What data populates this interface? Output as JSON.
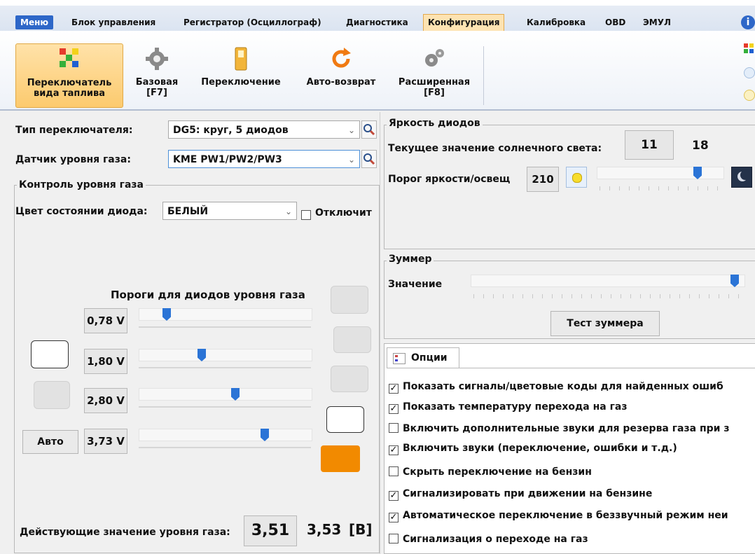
{
  "menu": {
    "tabs": [
      "Меню",
      "Блок управления",
      "Регистратор (Осциллограф)",
      "Диагностика",
      "Конфигурация",
      "Калибровка",
      "OBD",
      "ЭМУЛ"
    ],
    "active": "Конфигурация"
  },
  "ribbon": {
    "buttons": [
      {
        "label": "Переключатель вида таплива",
        "icon": "fuel-switch-icon"
      },
      {
        "label": "Базовая [F7]",
        "icon": "gear-icon"
      },
      {
        "label": "Переключение",
        "icon": "switch-icon"
      },
      {
        "label": "Авто-возврат",
        "icon": "refresh-icon"
      },
      {
        "label": "Расширенная [F8]",
        "icon": "gears-icon"
      }
    ]
  },
  "left": {
    "switch_type_label": "Тип переключателя:",
    "switch_type_value": "DG5: круг, 5 диодов",
    "sensor_label": "Датчик уровня газа:",
    "sensor_value": "KME PW1/PW2/PW3",
    "gas_group_title": "Контроль уровня газа",
    "led_color_label": "Цвет состоянии диода:",
    "led_color_value": "БЕЛЫЙ",
    "disable_label": "Отключит",
    "thresholds_title": "Пороги для диодов уровня газа",
    "thresholds": [
      {
        "value": "0,78 V",
        "fraction": 0.16
      },
      {
        "value": "1,80 V",
        "fraction": 0.37
      },
      {
        "value": "2,80 V",
        "fraction": 0.55
      },
      {
        "value": "3,73 V",
        "fraction": 0.73
      }
    ],
    "auto_button": "Авто",
    "current_label": "Действующие значение уровня газа:",
    "current_value": "3,51",
    "current_value2": "3,53",
    "unit": "[В]"
  },
  "brightness": {
    "title": "Яркость диодов",
    "sun_label": "Текущее значение солнечного света:",
    "sun_value1": "11",
    "sun_value2": "18",
    "threshold_label": "Порог яркости/освещ",
    "threshold_value": "210",
    "slider_fraction": 0.82
  },
  "buzzer": {
    "title": "Зуммер",
    "value_label": "Значение",
    "test_button": "Тест зуммера",
    "slider_fraction": 0.98
  },
  "options": {
    "tab_label": "Опции",
    "items": [
      {
        "label": "Показать сигналы/цветовые коды для найденных ошиб",
        "checked": true
      },
      {
        "label": "Показать температуру перехода на газ",
        "checked": true
      },
      {
        "label": "Включить дополнительные звуки для резерва газа при з",
        "checked": false
      },
      {
        "label": "Включить звуки (переключение, ошибки и т.д.)",
        "checked": true
      },
      {
        "label": "Скрыть переключение на бензин",
        "checked": false
      },
      {
        "label": "Сигнализировать при движении на бензине",
        "checked": true
      },
      {
        "label": "Автоматическое переключение в беззвучный режим неи",
        "checked": true
      },
      {
        "label": "Сигнализация о переходе на газ",
        "checked": false
      }
    ]
  },
  "colors": {
    "accent": "#2b74d6",
    "orange": "#f28a00",
    "menu_blue": "#2e67c8"
  }
}
